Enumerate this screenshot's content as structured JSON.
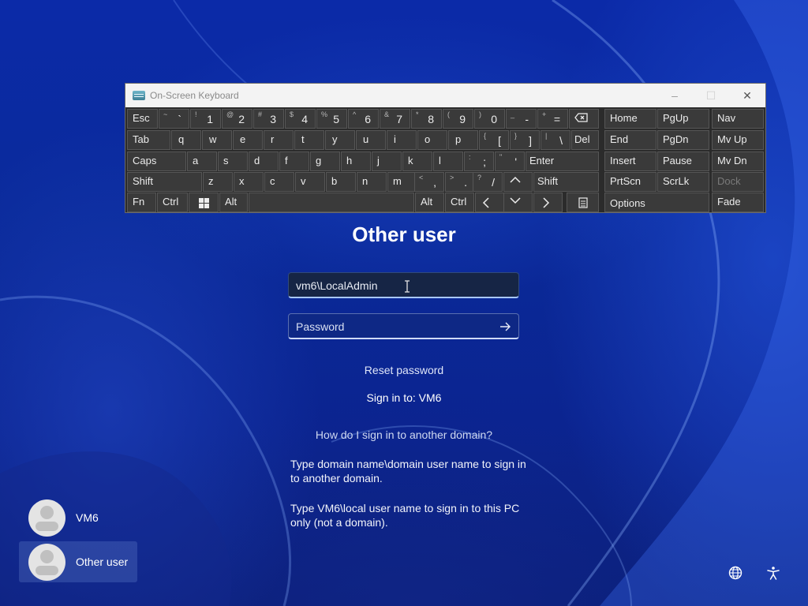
{
  "keyboard": {
    "title": "On-Screen Keyboard",
    "controls": {
      "minimize": "–",
      "maximize": "☐",
      "close": "✕"
    },
    "row1": {
      "esc": "Esc",
      "tilde_sh": "~",
      "tilde_mn": "`",
      "k1_sh": "!",
      "k1": "1",
      "k2_sh": "@",
      "k2": "2",
      "k3_sh": "#",
      "k3": "3",
      "k4_sh": "$",
      "k4": "4",
      "k5_sh": "%",
      "k5": "5",
      "k6_sh": "^",
      "k6": "6",
      "k7_sh": "&",
      "k7": "7",
      "k8_sh": "*",
      "k8": "8",
      "k9_sh": "(",
      "k9": "9",
      "k0_sh": ")",
      "k0": "0",
      "minus_sh": "_",
      "minus": "-",
      "eq_sh": "+",
      "eq": "="
    },
    "row2": {
      "tab": "Tab",
      "q": "q",
      "w": "w",
      "e": "e",
      "r": "r",
      "t": "t",
      "y": "y",
      "u": "u",
      "i": "i",
      "o": "o",
      "p": "p",
      "lb_sh": "{",
      "lb": "[",
      "rb_sh": "}",
      "rb": "]",
      "bs_sh": "|",
      "bs": "\\",
      "del": "Del"
    },
    "row3": {
      "caps": "Caps",
      "a": "a",
      "s": "s",
      "d": "d",
      "f": "f",
      "g": "g",
      "h": "h",
      "j": "j",
      "k": "k",
      "l": "l",
      "semi_sh": ":",
      "semi": ";",
      "quote_sh": "\"",
      "quote": "'",
      "enter": "Enter"
    },
    "row4": {
      "shift": "Shift",
      "z": "z",
      "x": "x",
      "c": "c",
      "v": "v",
      "b": "b",
      "n": "n",
      "m": "m",
      "comma_sh": "<",
      "comma": ",",
      "period_sh": ">",
      "period": ".",
      "slash_sh": "?",
      "slash": "/",
      "shift_r": "Shift"
    },
    "row5": {
      "fn": "Fn",
      "ctrl": "Ctrl",
      "alt": "Alt",
      "alt_r": "Alt",
      "ctrl_r": "Ctrl"
    },
    "nav": {
      "home": "Home",
      "pgup": "PgUp",
      "nav": "Nav",
      "end": "End",
      "pgdn": "PgDn",
      "mvup": "Mv Up",
      "insert": "Insert",
      "pause": "Pause",
      "mvdn": "Mv Dn",
      "prtscn": "PrtScn",
      "scrlk": "ScrLk",
      "dock": "Dock",
      "options": "Options",
      "fade": "Fade"
    }
  },
  "login": {
    "title": "Other user",
    "username_value": "vm6\\LocalAdmin",
    "password_placeholder": "Password",
    "reset_password": "Reset password",
    "sign_in_to": "Sign in to: VM6",
    "help_question": "How do I sign in to another domain?",
    "help_text_1": "Type domain name\\domain user name to sign in to another domain.",
    "help_text_2": "Type VM6\\local user name to sign in to this PC only (not a domain)."
  },
  "users": [
    {
      "name": "VM6"
    },
    {
      "name": "Other user"
    }
  ],
  "tray": {
    "network_icon": "globe-network-icon",
    "accessibility_icon": "accessibility-icon"
  }
}
